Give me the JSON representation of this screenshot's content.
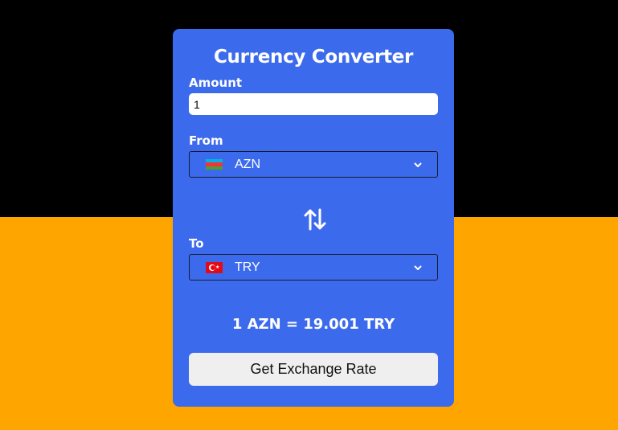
{
  "page": {
    "background_top": "#000000",
    "background_bottom": "#FFA500"
  },
  "card": {
    "background": "#3C6AEC",
    "title": "Currency Converter",
    "amount": {
      "label": "Amount",
      "value": "1"
    },
    "from": {
      "label": "From",
      "currency": "AZN",
      "flag": "azerbaijan-flag-icon"
    },
    "to": {
      "label": "To",
      "currency": "TRY",
      "flag": "turkey-flag-icon"
    },
    "swap_icon": "swap-arrows-icon",
    "result": "1 AZN = 19.001 TRY",
    "button_label": "Get Exchange Rate"
  }
}
